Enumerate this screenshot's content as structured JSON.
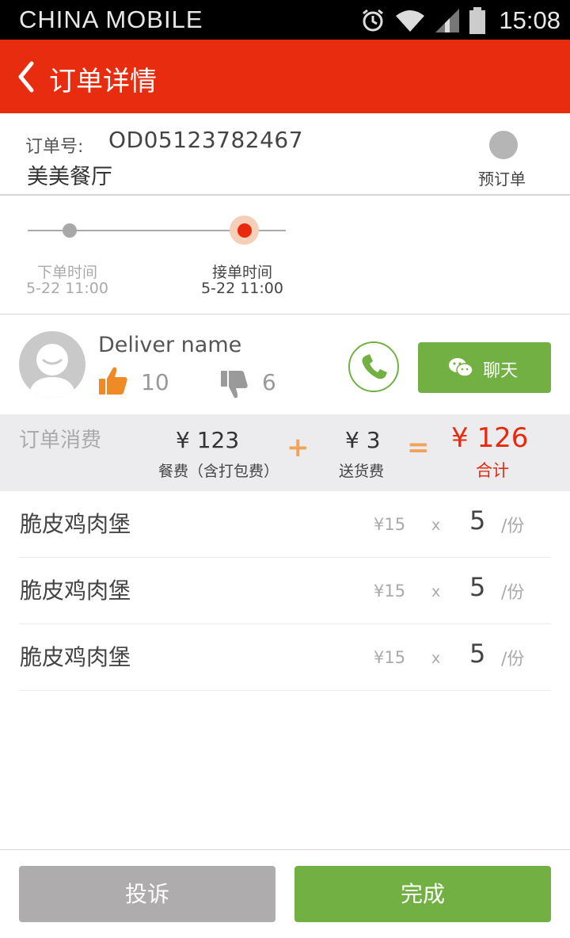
{
  "status_bar": {
    "carrier": "CHINA  MOBILE",
    "time": "15:08"
  },
  "header": {
    "title": "订单详情"
  },
  "order": {
    "number_label": "订单号:",
    "number": "OD05123782467",
    "shop_name": "美美餐厅",
    "preorder_label": "预订单"
  },
  "timeline": [
    {
      "label": "下单时间",
      "time": "5-22 11:00",
      "active": false
    },
    {
      "label": "接单时间",
      "time": "5-22 11:00",
      "active": true
    }
  ],
  "deliverer": {
    "name": "Deliver name",
    "likes": "10",
    "dislikes": "6",
    "chat_label": "聊天"
  },
  "cost": {
    "title": "订单消费",
    "meal_amount": "¥  123",
    "meal_label": "餐费（含打包费）",
    "plus": "+",
    "delivery_amount": "¥ 3",
    "delivery_label": "送货费",
    "equals": "=",
    "total_amount": "¥ 126",
    "total_label": "合计"
  },
  "items": [
    {
      "name": "脆皮鸡肉堡",
      "price": "¥15",
      "times": "x",
      "qty": "5",
      "unit": "/份"
    },
    {
      "name": "脆皮鸡肉堡",
      "price": "¥15",
      "times": "x",
      "qty": "5",
      "unit": "/份"
    },
    {
      "name": "脆皮鸡肉堡",
      "price": "¥15",
      "times": "x",
      "qty": "5",
      "unit": "/份"
    }
  ],
  "footer": {
    "complain_label": "投诉",
    "complete_label": "完成"
  },
  "colors": {
    "brand_red": "#e82c10",
    "accent_green": "#72b044",
    "operator_orange": "#f0a35a"
  }
}
